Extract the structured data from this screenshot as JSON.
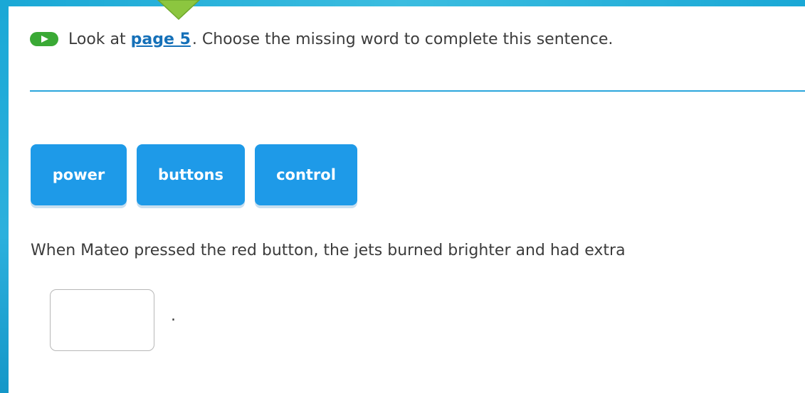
{
  "instruction": {
    "prefix": "Look at",
    "link_text": "page 5",
    "suffix": ". Choose the missing word to complete this sentence."
  },
  "word_bank": [
    {
      "label": "power"
    },
    {
      "label": "buttons"
    },
    {
      "label": "control"
    }
  ],
  "question": {
    "sentence": "When Mateo pressed the red button, the jets burned brighter and had extra",
    "answer_value": "",
    "ending": "."
  },
  "colors": {
    "accent_blue": "#1e9ae8",
    "link": "#1570b8",
    "play_green": "#3aa935",
    "frame": "#1aa8d6"
  },
  "icons": {
    "play": "play-icon",
    "pointer": "tab-pointer-arrow"
  }
}
